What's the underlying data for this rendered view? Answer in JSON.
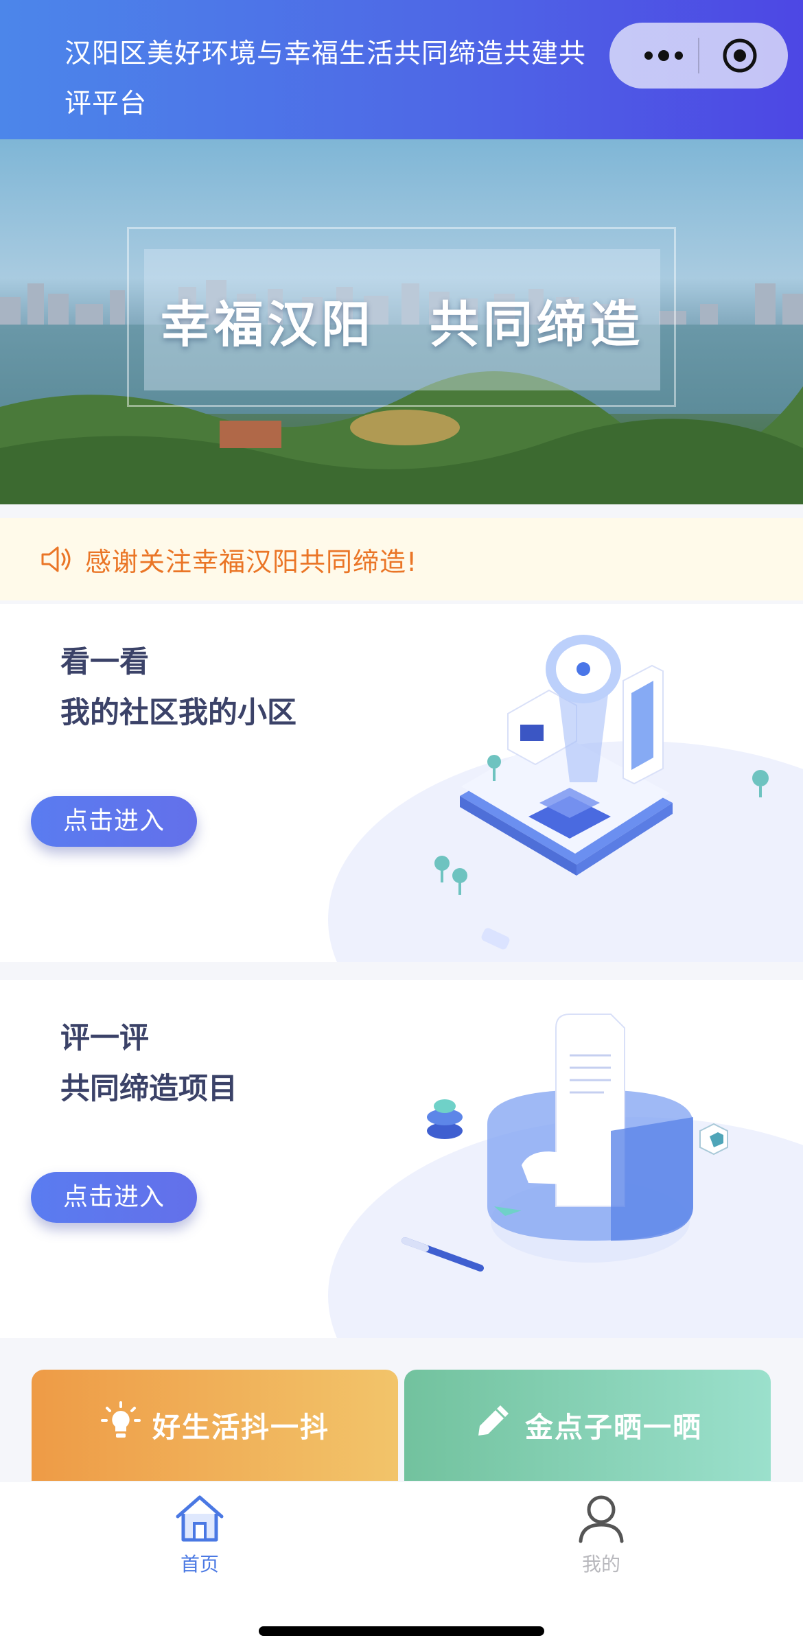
{
  "header": {
    "title": "汉阳区美好环境与幸福生活共同缔造共建共评平台",
    "menu_icon": "more-dots-icon",
    "close_icon": "target-circle-icon"
  },
  "banner": {
    "left_text": "幸福汉阳",
    "right_text": "共同缔造"
  },
  "notice": {
    "icon": "speaker-icon",
    "text": "感谢关注幸福汉阳共同缔造!"
  },
  "cards": [
    {
      "line1": "看一看",
      "line2": "我的社区我的小区",
      "button": "点击进入"
    },
    {
      "line1": "评一评",
      "line2": "共同缔造项目",
      "button": "点击进入"
    }
  ],
  "actions": [
    {
      "label": "好生活抖一抖",
      "icon": "lightbulb-icon",
      "color": "#ee9b46"
    },
    {
      "label": "金点子晒一晒",
      "icon": "pencil-icon",
      "color": "#72c29e"
    }
  ],
  "tabbar": {
    "active_color": "#4a78e3",
    "inactive_color": "#b8b8bd",
    "items": [
      {
        "label": "首页",
        "icon": "home-icon",
        "active": true
      },
      {
        "label": "我的",
        "icon": "user-icon",
        "active": false
      }
    ]
  }
}
